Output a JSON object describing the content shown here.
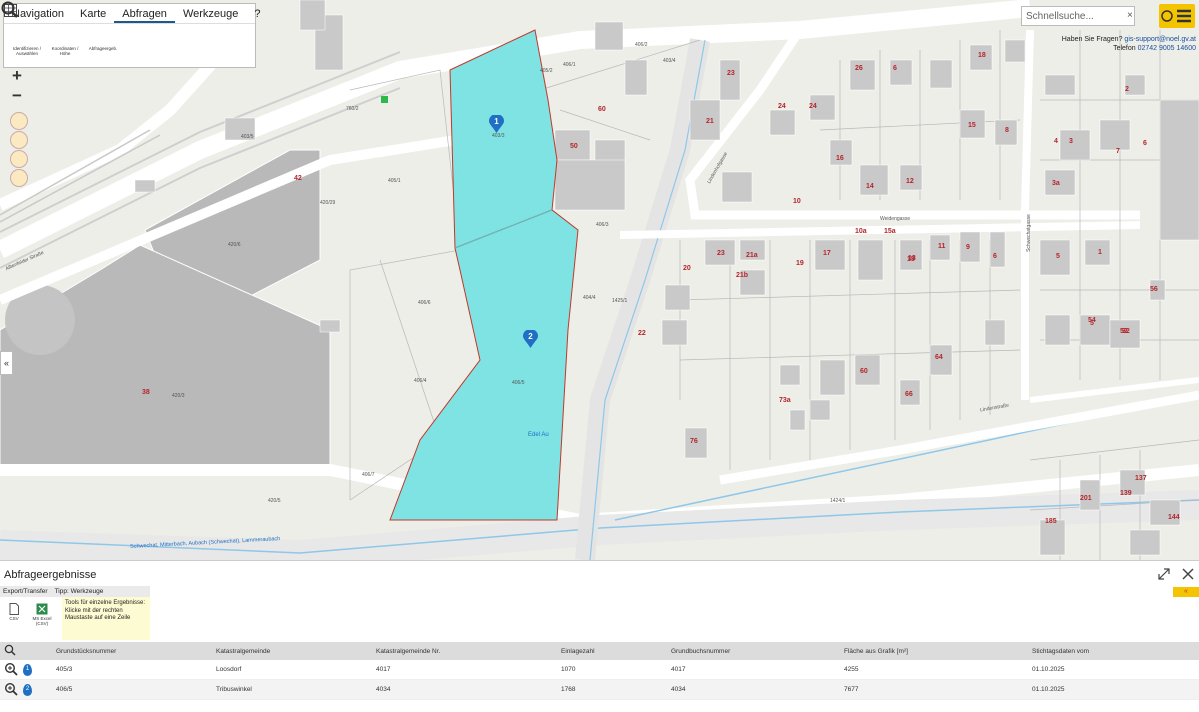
{
  "menu": {
    "tabs": [
      "Navigation",
      "Karte",
      "Abfragen",
      "Werkzeuge",
      "?"
    ],
    "tools": [
      {
        "label": "Identifizieren / Auswählen",
        "icon": "info-icon"
      },
      {
        "label": "Koordinaten / Höhe",
        "icon": "coordinates-icon"
      },
      {
        "label": "Abfrageergeb.",
        "icon": "table-icon"
      }
    ]
  },
  "search": {
    "placeholder": "Schnellsuche...",
    "clear": "×"
  },
  "help": {
    "line1": "Haben Sie Fragen?",
    "email": "gis-support@noel.gv.at",
    "phone_label": "Telefon",
    "phone": "02742 9005 14600"
  },
  "map": {
    "parcel_labels": [
      "403/3",
      "406/5",
      "405/2",
      "405/1",
      "406/6",
      "406/4",
      "420/6",
      "406/7",
      "404/4",
      "420/3",
      "420/29",
      "420/5",
      "1425/1",
      "1424/1",
      "760/2",
      "406/3",
      "406/2",
      "406/1",
      "403/4",
      "403/5"
    ],
    "house_numbers": [
      "60",
      "42",
      "38",
      "50",
      "21a",
      "32",
      "26",
      "6",
      "18",
      "3",
      "5",
      "1",
      "21b",
      "19",
      "15",
      "17",
      "23",
      "10",
      "24",
      "16",
      "14",
      "12",
      "8",
      "10a",
      "15a",
      "11",
      "9",
      "13",
      "24",
      "6",
      "22",
      "20",
      "76",
      "64",
      "66",
      "60",
      "73a",
      "5",
      "7",
      "52",
      "54",
      "56",
      "3a",
      "185",
      "201",
      "139",
      "137",
      "144",
      "4",
      "6",
      "2",
      "21",
      "23",
      "15"
    ],
    "street_names": [
      "Schwechat, Mitterbach, Aubach (Schwechat), Lammeraubach",
      "Weidengasse",
      "Edel Au",
      "Lindenstraße",
      "Lindenhofgasse",
      "Alltenfelder Straße",
      "Schwechatgasse"
    ],
    "markers": [
      "1",
      "2"
    ]
  },
  "panel": {
    "title": "Abfrageergebnisse",
    "export_tab": "Export/Transfer",
    "tipp_tab": "Tipp: Werkzeuge",
    "export_items": [
      "CSV",
      "MS Excel (CSV)"
    ],
    "tipp_text": "Tools für einzelne Ergebnisse: Klicke mit der rechten Maustaste auf eine Zeile",
    "yellow_button": "«",
    "columns": [
      "Grundstücksnummer",
      "Katastralgemeinde",
      "Katastralgemeinde Nr.",
      "Einlagezahl",
      "Grundbuchsnummer",
      "Fläche aus Grafik [m²]",
      "Stichtagsdaten vom"
    ],
    "rows": [
      {
        "marker": "1",
        "cells": [
          "405/3",
          "Loosdorf",
          "4017",
          "1070",
          "4017",
          "4255",
          "01.10.2025"
        ]
      },
      {
        "marker": "2",
        "cells": [
          "406/5",
          "Tribuswinkel",
          "4034",
          "1768",
          "4034",
          "7677",
          "01.10.2025"
        ]
      }
    ]
  },
  "colors": {
    "highlight": "#7fe3e3",
    "highlight_border": "#c0392b",
    "accent": "#f5c400",
    "marker": "#1f6fc4"
  }
}
